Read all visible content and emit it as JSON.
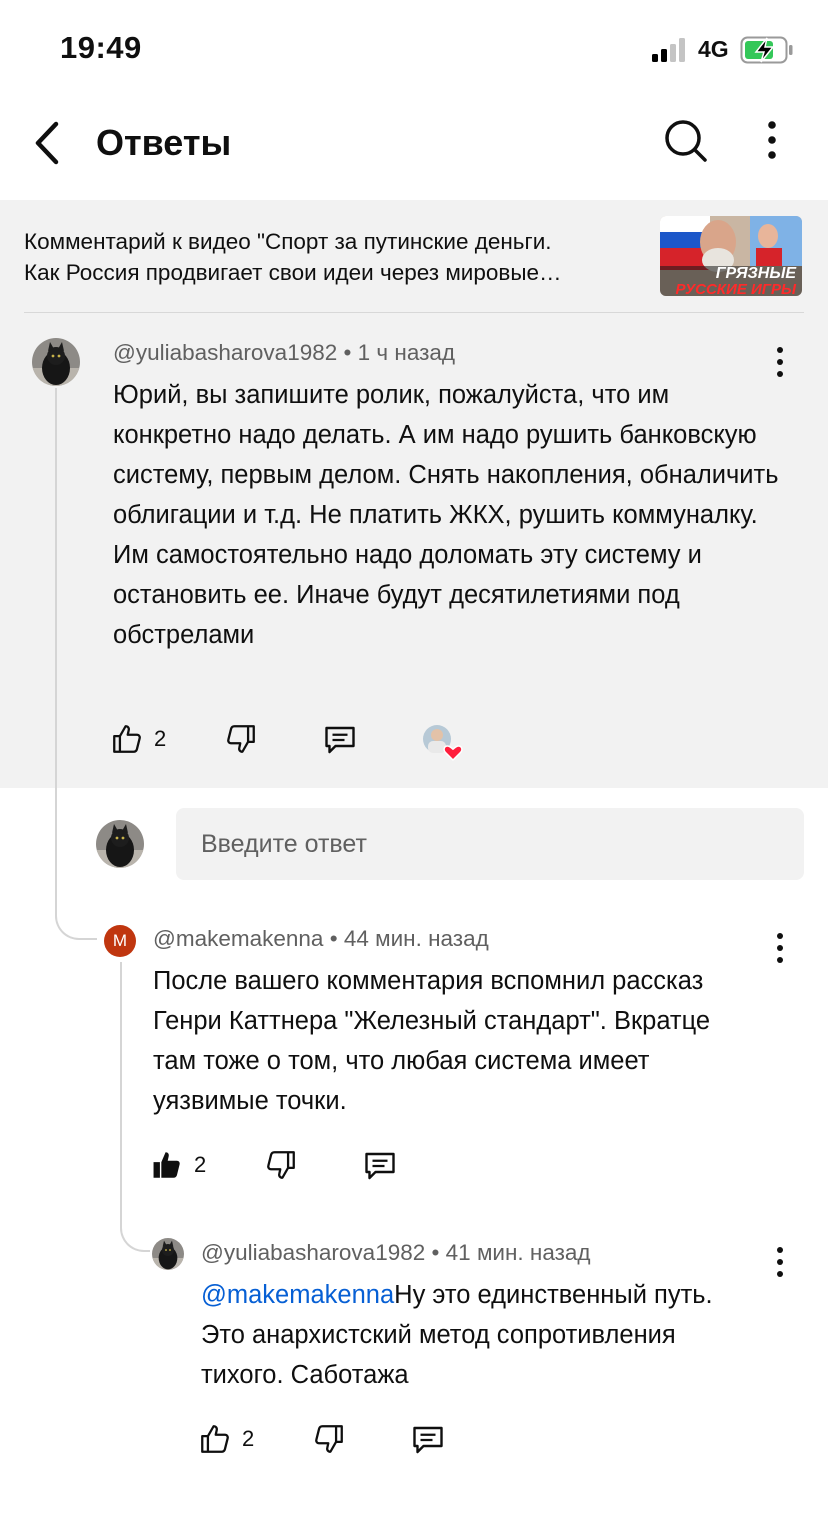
{
  "status": {
    "time": "19:49",
    "network": "4G"
  },
  "header": {
    "title": "Ответы"
  },
  "video": {
    "line1": "Комментарий к видео \"Спорт за путинские деньги.",
    "line2": "Как Россия продвигает свои идеи через мировые…",
    "thumb_text1": "ГРЯЗНЫЕ",
    "thumb_text2": "РУССКИЕ ИГРЫ"
  },
  "comments": [
    {
      "author": "@yuliabasharova1982",
      "time": "1 ч назад",
      "text": "Юрий, вы запишите ролик, пожалуйста, что им конкретно надо делать. А им надо рушить банковскую систему, первым делом. Снять накопления, обналичить облигации и т.д. Не платить ЖКХ, рушить коммуналку. Им самостоятельно надо доломать эту систему и остановить ее. Иначе будут десятилетиями под обстрелами",
      "likes": "2"
    },
    {
      "author": "@makemakenna",
      "avatar_letter": "M",
      "time": "44 мин. назад",
      "text": "После вашего комментария вспомнил рассказ Генри Каттнера \"Железный стандарт\". Вкратце там тоже о том, что любая система имеет уязвимые точки.",
      "likes": "2"
    },
    {
      "author": "@yuliabasharova1982",
      "time": "41 мин. назад",
      "mention": "@makemakenna",
      "text": "Ну это единственный путь. Это анархистский метод сопротивления тихого. Саботажа",
      "likes": "2"
    }
  ],
  "reply": {
    "placeholder": "Введите ответ"
  },
  "separator": "•",
  "colors": {
    "mention": "#065fd4",
    "creator_heart": "#ff1e3c",
    "letter_avatar": "#c0360f"
  }
}
